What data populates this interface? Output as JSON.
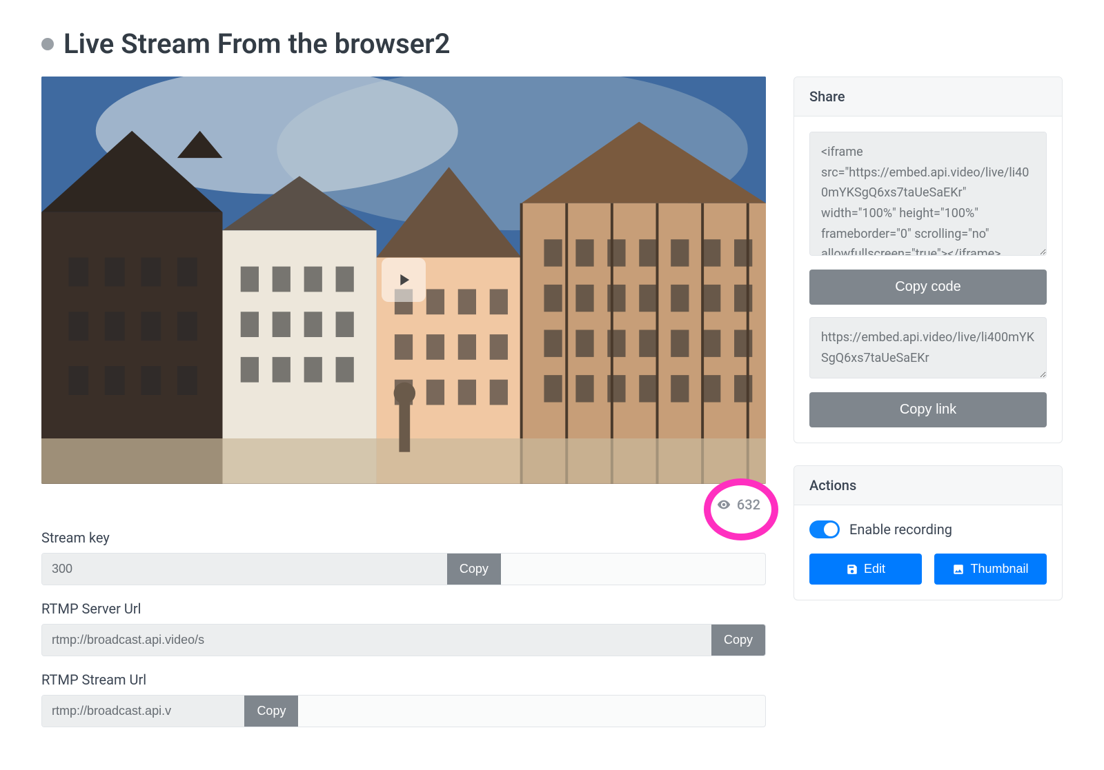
{
  "header": {
    "title": "Live Stream From the browser2"
  },
  "player": {
    "views": "632"
  },
  "fields": {
    "stream_key": {
      "label": "Stream key",
      "value": "300",
      "copy": "Copy"
    },
    "rtmp_server": {
      "label": "RTMP Server Url",
      "value": "rtmp://broadcast.api.video/s",
      "copy": "Copy"
    },
    "rtmp_stream": {
      "label": "RTMP Stream Url",
      "value": "rtmp://broadcast.api.v",
      "copy": "Copy"
    }
  },
  "share": {
    "title": "Share",
    "embed_code": "<iframe src=\"https://embed.api.video/live/li400mYKSgQ6xs7taUeSaEKr\" width=\"100%\" height=\"100%\" frameborder=\"0\" scrolling=\"no\" allowfullscreen=\"true\"></iframe>",
    "copy_code_label": "Copy code",
    "link": "https://embed.api.video/live/li400mYKSgQ6xs7taUeSaEKr",
    "copy_link_label": "Copy link"
  },
  "actions": {
    "title": "Actions",
    "enable_recording_label": "Enable recording",
    "edit_label": "Edit",
    "thumbnail_label": "Thumbnail"
  }
}
